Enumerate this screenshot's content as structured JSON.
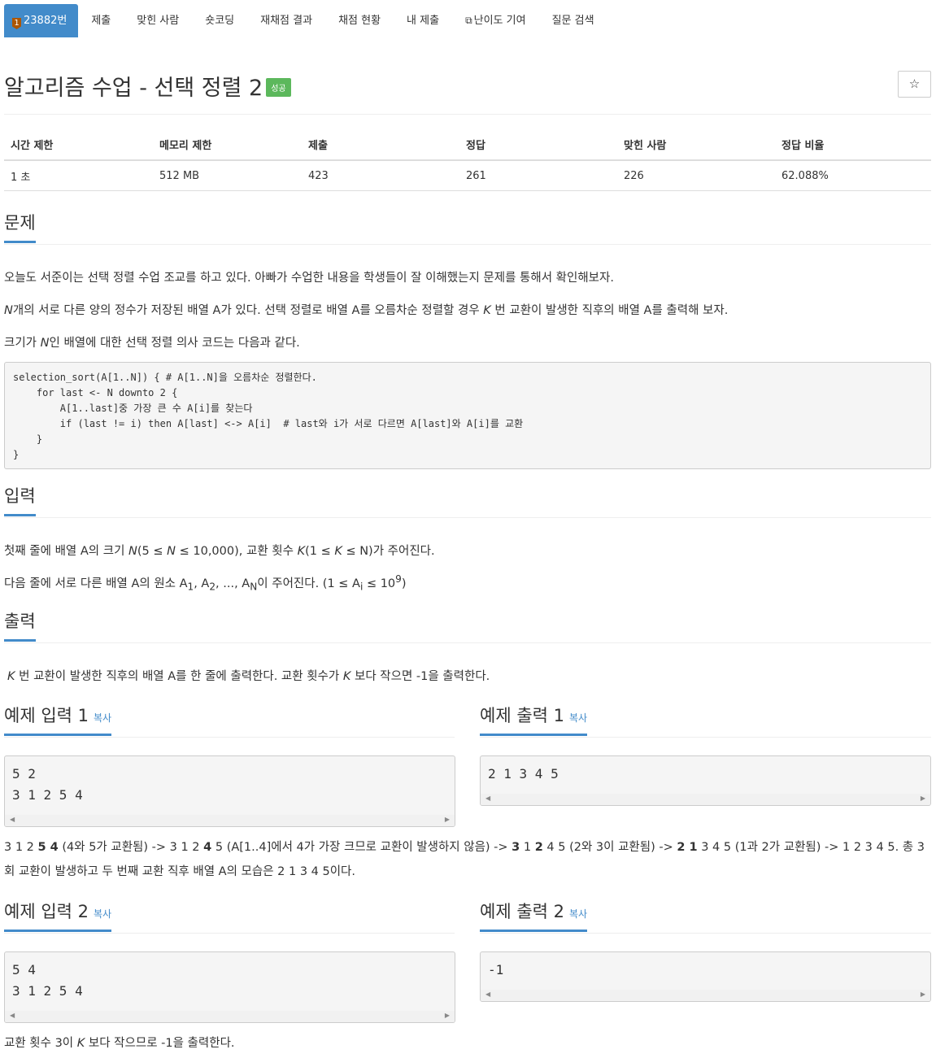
{
  "nav": {
    "problem_number": "23882번",
    "tier_icon_text": "1",
    "tabs": [
      "제출",
      "맞힌 사람",
      "숏코딩",
      "재채점 결과",
      "채점 현황",
      "내 제출"
    ],
    "contrib_icon": "external-link-icon",
    "contrib_label": "난이도 기여",
    "search_label": "질문 검색"
  },
  "problem": {
    "title": "알고리즘 수업 - 선택 정렬 2",
    "badge": "성공",
    "star": "☆"
  },
  "info": {
    "headers": [
      "시간 제한",
      "메모리 제한",
      "제출",
      "정답",
      "맞힌 사람",
      "정답 비율"
    ],
    "values": [
      "1 초",
      "512 MB",
      "423",
      "261",
      "226",
      "62.088%"
    ]
  },
  "sections": {
    "problem": "문제",
    "input": "입력",
    "output": "출력",
    "sample_input_1": "예제 입력 1",
    "sample_output_1": "예제 출력 1",
    "sample_input_2": "예제 입력 2",
    "sample_output_2": "예제 출력 2",
    "copy": "복사"
  },
  "desc": {
    "p1": "오늘도 서준이는 선택 정렬 수업 조교를 하고 있다. 아빠가 수업한 내용을 학생들이 잘 이해했는지 문제를 통해서 확인해보자.",
    "p2_n": "N",
    "p2_a": "개의 서로 다른 양의 정수가 저장된 배열 A가 있다. 선택 정렬로 배열 A를 오름차순 정렬할 경우 ",
    "p2_k": "K",
    "p2_b": " 번 교환이 발생한 직후의 배열 A를 출력해 보자.",
    "p3_a": "크기가 ",
    "p3_n": "N",
    "p3_b": "인 배열에 대한 선택 정렬 의사 코드는 다음과 같다.",
    "code": "selection_sort(A[1..N]) { # A[1..N]을 오름차순 정렬한다.\n    for last <- N downto 2 {\n        A[1..last]중 가장 큰 수 A[i]를 찾는다\n        if (last != i) then A[last] <-> A[i]  # last와 i가 서로 다르면 A[last]와 A[i]를 교환\n    }\n}"
  },
  "input_desc": {
    "l1_a": "첫째 줄에 배열 A의 크기 ",
    "l1_n": "N",
    "l1_b": "(5 ≤ ",
    "l1_n2": "N",
    "l1_c": " ≤ 10,000), 교환 횟수 ",
    "l1_k": "K",
    "l1_d": "(1 ≤ ",
    "l1_k2": "K",
    "l1_e": " ≤ N)가 주어진다.",
    "l2_a": "다음 줄에 서로 다른 배열 A의 원소 A",
    "l2_s1": "1",
    "l2_b": ", A",
    "l2_s2": "2",
    "l2_c": ", ..., A",
    "l2_sn": "N",
    "l2_d": "이 주어진다. (1 ≤ A",
    "l2_si": "i",
    "l2_e": " ≤ 10",
    "l2_sup": "9",
    "l2_f": ")"
  },
  "output_desc": {
    "k": "K",
    "a": " 번 교환이 발생한 직후의 배열 A를 한 줄에 출력한다. 교환 횟수가 ",
    "k2": "K",
    "b": " 보다 작으면 -1을 출력한다."
  },
  "samples": {
    "in1": "5 2\n3 1 2 5 4",
    "out1": "2 1 3 4 5",
    "in2": "5 4\n3 1 2 5 4",
    "out2": "-1"
  },
  "explain1": {
    "t1": "3 1 2 ",
    "b1": "5 4",
    "t2": " (4와 5가 교환됨) -> 3 1 2 ",
    "b2": "4",
    "t3": " 5 (A[1..4]에서 4가 가장 크므로 교환이 발생하지 않음) -> ",
    "b3": "3",
    "t4": " 1 ",
    "b4": "2",
    "t5": " 4 5 (2와 3이 교환됨) -> ",
    "b5": "2 1",
    "t6": " 3 4 5 (1과 2가 교환됨) -> 1 2 3 4 5. 총 3회 교환이 발생하고 두 번째 교환 직후 배열 A의 모습은 2 1 3 4 5이다."
  },
  "explain2": {
    "a": "교환 횟수 3이 ",
    "k": "K",
    "b": " 보다 작으므로 -1을 출력한다."
  }
}
